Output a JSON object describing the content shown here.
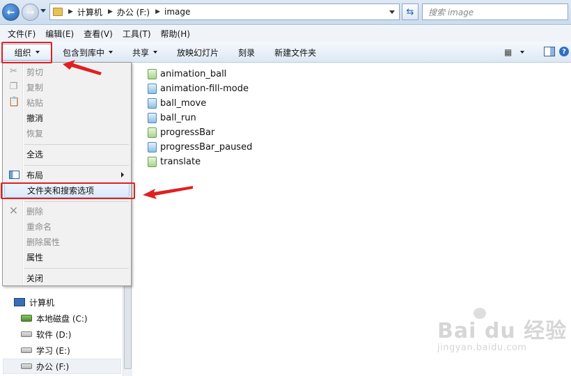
{
  "address_bar": {
    "breadcrumbs": [
      "计算机",
      "办公 (F:)",
      "image"
    ],
    "search_placeholder": "搜索 image"
  },
  "menu_bar": {
    "items": [
      "文件(F)",
      "编辑(E)",
      "查看(V)",
      "工具(T)",
      "帮助(H)"
    ]
  },
  "command_bar": {
    "organize": "组织",
    "include_in_library": "包含到库中",
    "share": "共享",
    "slideshow": "放映幻灯片",
    "burn": "刻录",
    "new_folder": "新建文件夹"
  },
  "organize_menu": {
    "items": [
      {
        "label": "剪切",
        "enabled": false,
        "icon": "scissors-icon"
      },
      {
        "label": "复制",
        "enabled": false,
        "icon": "copy-icon"
      },
      {
        "label": "粘贴",
        "enabled": false,
        "icon": "paste-icon"
      },
      {
        "label": "撤消",
        "enabled": true
      },
      {
        "label": "恢复",
        "enabled": false
      },
      {
        "label": "全选",
        "enabled": true
      },
      {
        "label": "布局",
        "enabled": true,
        "icon": "layout-icon",
        "submenu": true
      },
      {
        "label": "文件夹和搜索选项",
        "enabled": true,
        "highlighted": true
      },
      {
        "label": "删除",
        "enabled": false,
        "icon": "delete-icon"
      },
      {
        "label": "重命名",
        "enabled": false
      },
      {
        "label": "删除属性",
        "enabled": false
      },
      {
        "label": "属性",
        "enabled": true
      },
      {
        "label": "关闭",
        "enabled": true
      }
    ]
  },
  "nav_tree": {
    "items": [
      {
        "label": "计算机",
        "icon": "computer-icon"
      },
      {
        "label": "本地磁盘 (C:)",
        "icon": "system-drive-icon"
      },
      {
        "label": "软件 (D:)",
        "icon": "drive-icon"
      },
      {
        "label": "学习 (E:)",
        "icon": "drive-icon"
      },
      {
        "label": "办公 (F:)",
        "icon": "drive-icon",
        "selected": true
      }
    ]
  },
  "files": [
    {
      "name": "animation_ball",
      "type": "png"
    },
    {
      "name": "animation-fill-mode",
      "type": "gif"
    },
    {
      "name": "ball_move",
      "type": "gif"
    },
    {
      "name": "ball_run",
      "type": "gif"
    },
    {
      "name": "progressBar",
      "type": "png"
    },
    {
      "name": "progressBar_paused",
      "type": "gif"
    },
    {
      "name": "translate",
      "type": "png"
    }
  ],
  "watermark": {
    "main": "Bai du 经验",
    "sub": "jingyan.baidu.com"
  },
  "colors": {
    "annotation_red": "#e02020",
    "highlight_border": "#a9c8ef"
  }
}
